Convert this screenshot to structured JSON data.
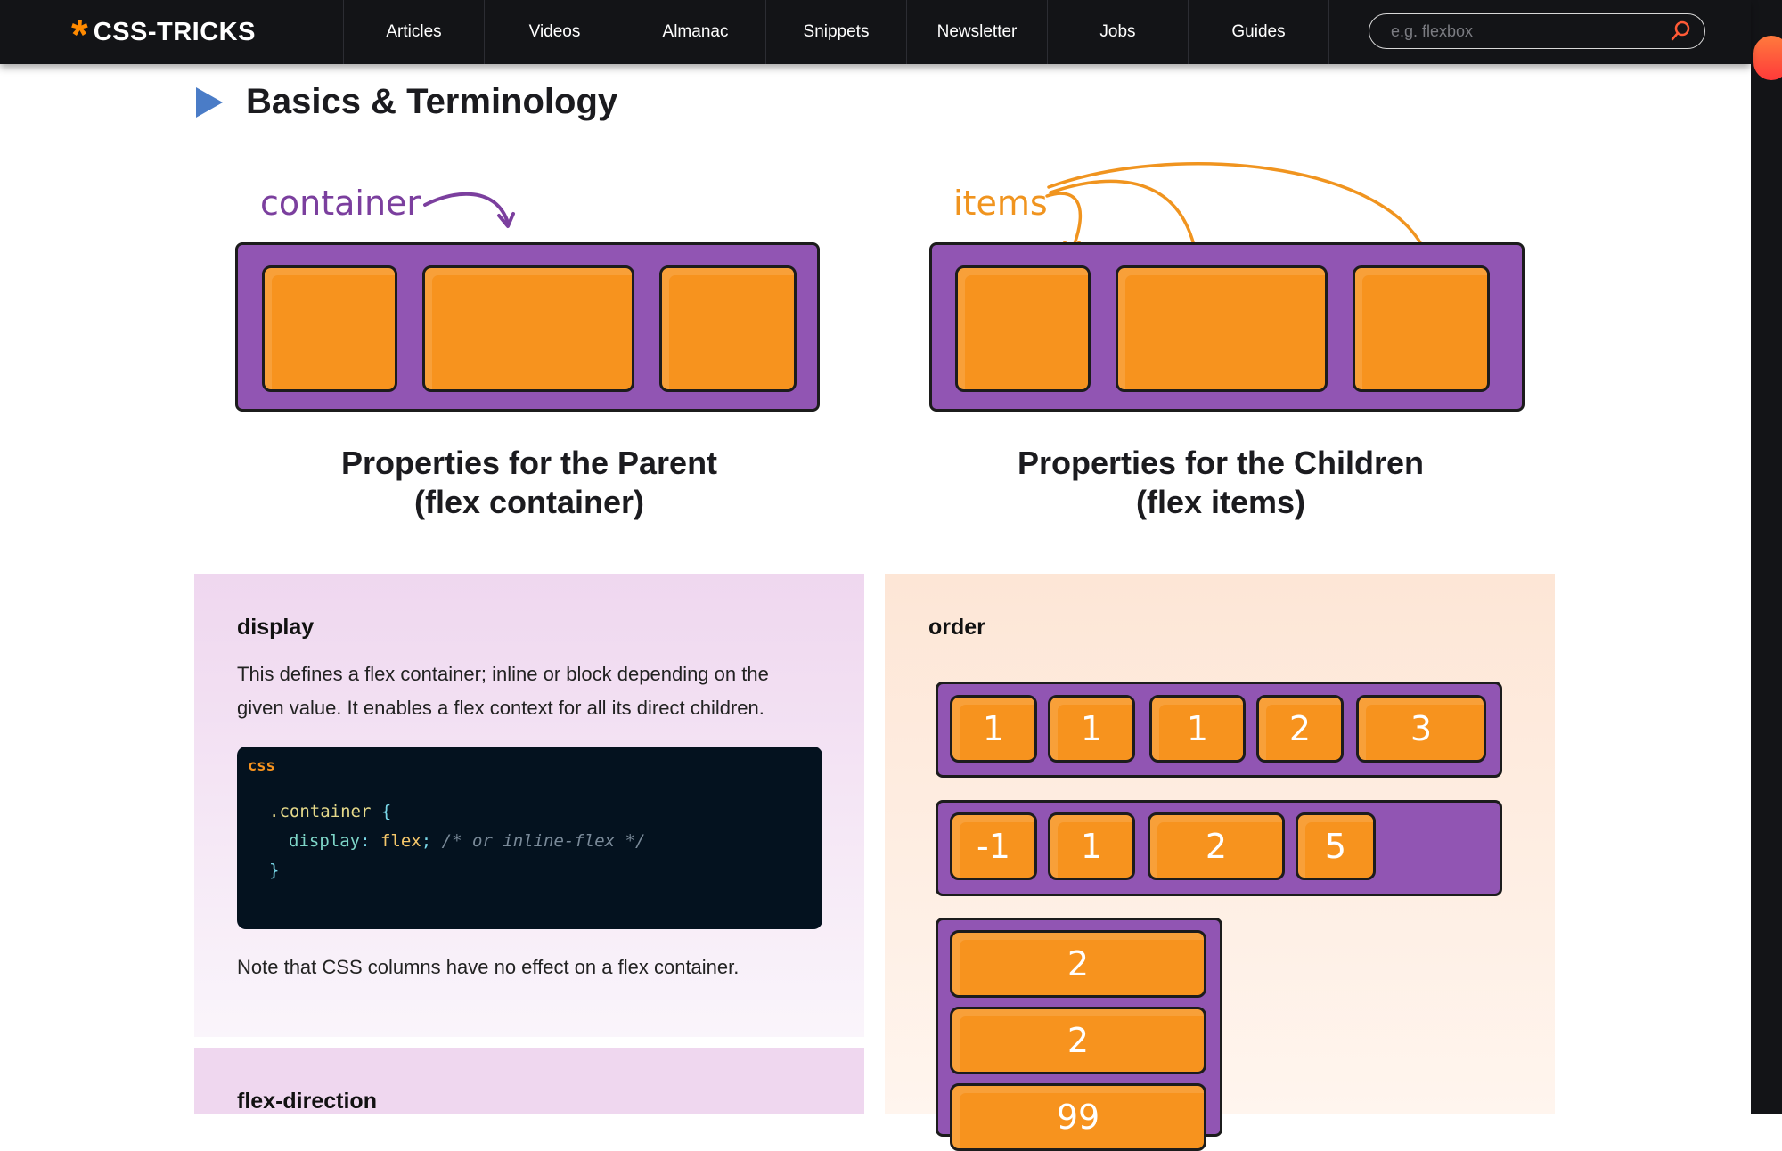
{
  "nav": {
    "logo_text": "CSS-TRICKS",
    "logo_mark": "*",
    "links": [
      "Articles",
      "Videos",
      "Almanac",
      "Snippets",
      "Newsletter",
      "Jobs",
      "Guides"
    ],
    "search_placeholder": "e.g. flexbox",
    "search_icon": "search-icon"
  },
  "section": {
    "title": "Basics & Terminology",
    "marker_icon": "play-triangle-icon"
  },
  "illustrations": {
    "parent_annotation": "container",
    "children_annotation": "items"
  },
  "columns": {
    "parent_title_line1": "Properties for the Parent",
    "parent_title_line2": "(flex container)",
    "children_title_line1": "Properties for the Children",
    "children_title_line2": "(flex items)"
  },
  "display_card": {
    "heading": "display",
    "description_line1": "This defines a flex container; inline or block depending on the",
    "description_line2": "given value. It enables a flex context for all its direct children.",
    "code_lang": "css",
    "code": {
      "selector": ".container",
      "open_brace": "{",
      "property": "display",
      "colon": ":",
      "value": "flex",
      "semicolon": ";",
      "comment": "/* or inline-flex */",
      "close_brace": "}"
    },
    "note": "Note that CSS columns have no effect on a flex container."
  },
  "flex_direction_card": {
    "heading": "flex-direction"
  },
  "order_card": {
    "heading": "order",
    "row1": [
      "1",
      "1",
      "1",
      "2",
      "3"
    ],
    "row2": [
      "-1",
      "1",
      "2",
      "5"
    ],
    "column": [
      "2",
      "2",
      "99"
    ]
  },
  "colors": {
    "nav_bg": "#131417",
    "accent_orange": "#f7931e",
    "tray_purple": "#9155b3",
    "annotation_purple": "#7b3f9e",
    "annotation_orange": "#f0941f",
    "play_blue": "#4a7cc7"
  }
}
